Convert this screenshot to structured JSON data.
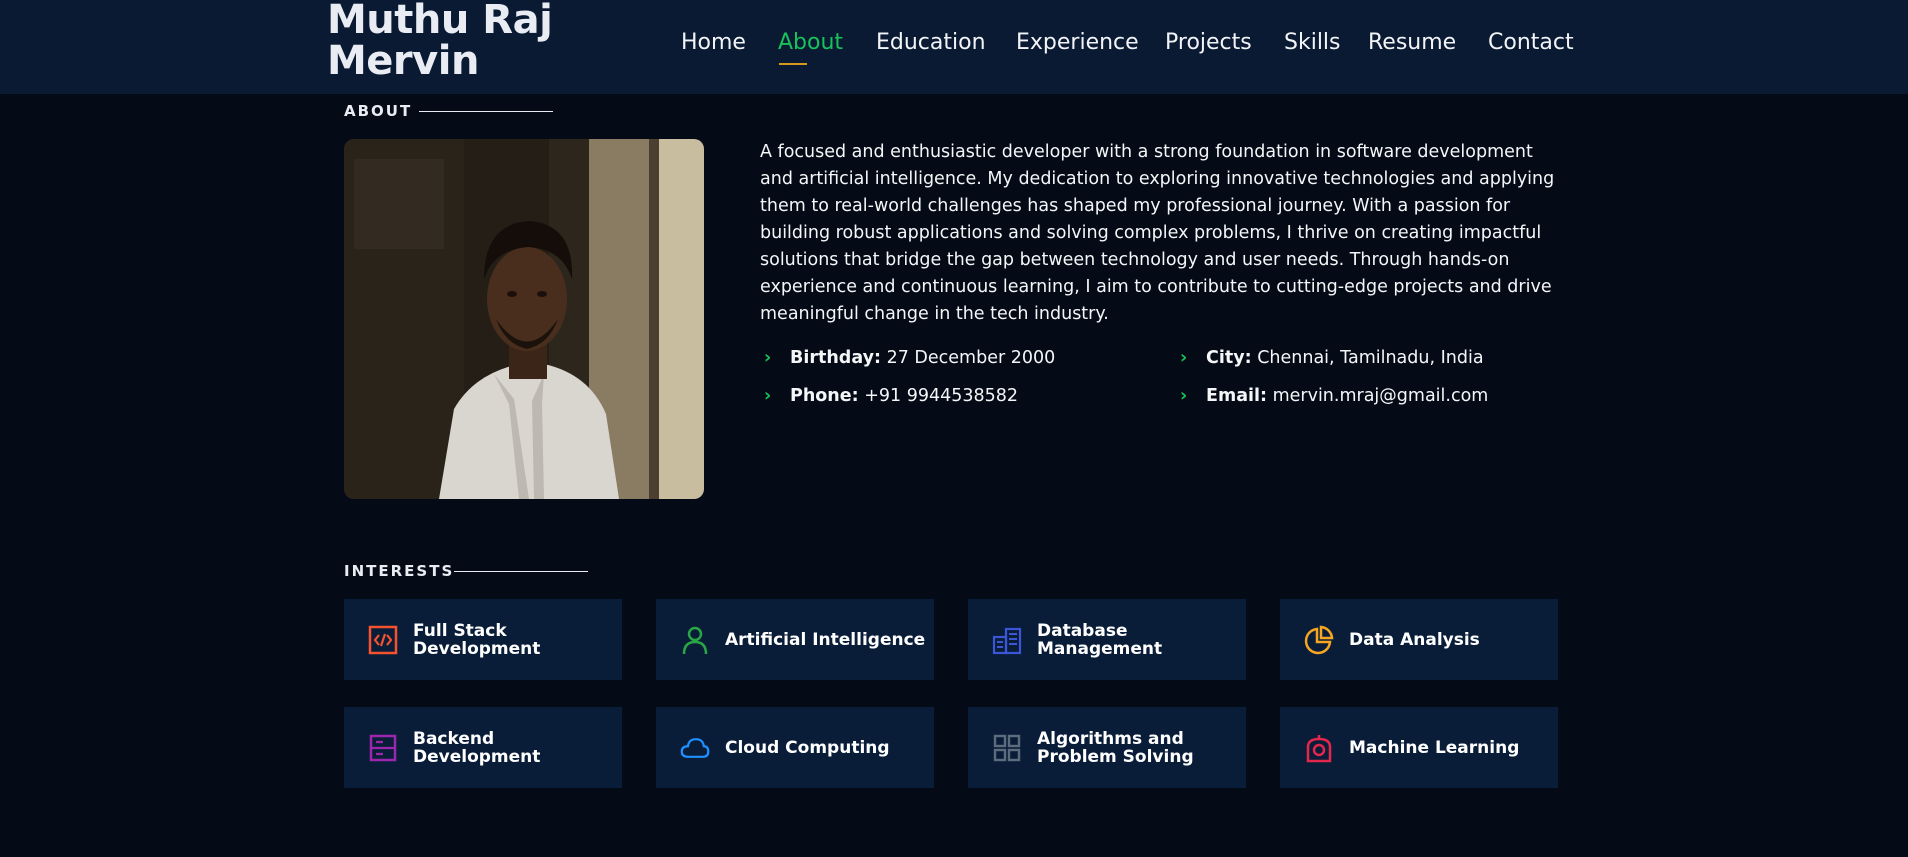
{
  "header": {
    "name_line1": "Muthu Raj",
    "name_line2": "Mervin",
    "nav": [
      "Home",
      "About",
      "Education",
      "Experience",
      "Projects",
      "Skills",
      "Resume",
      "Contact"
    ],
    "active_nav": "About"
  },
  "about": {
    "section_title": "ABOUT",
    "bio": "A focused and enthusiastic developer with a strong foundation in software development and artificial intelligence. My dedication to exploring innovative technologies and applying them to real-world challenges has shaped my professional journey. With a passion for building robust applications and solving complex problems, I thrive on creating impactful solutions that bridge the gap between technology and user needs. Through hands-on experience and continuous learning, I aim to contribute to cutting-edge projects and drive meaningful change in the tech industry.",
    "details": [
      {
        "label": "Birthday:",
        "value": "27 December 2000"
      },
      {
        "label": "City:",
        "value": "Chennai, Tamilnadu, India"
      },
      {
        "label": "Phone:",
        "value": "+91 9944538582"
      },
      {
        "label": "Email:",
        "value": "mervin.mraj@gmail.com"
      }
    ]
  },
  "interests": {
    "section_title": "INTERESTS",
    "items": [
      {
        "label": "Full Stack Development",
        "icon": "code-icon",
        "color": "#f4532e"
      },
      {
        "label": "Artificial Intelligence",
        "icon": "person-icon",
        "color": "#28a745"
      },
      {
        "label": "Database Management",
        "icon": "database-icon",
        "color": "#3b56d6"
      },
      {
        "label": "Data Analysis",
        "icon": "pie-chart-icon",
        "color": "#f5a623"
      },
      {
        "label": "Backend Development",
        "icon": "server-icon",
        "color": "#9b27af"
      },
      {
        "label": "Cloud Computing",
        "icon": "cloud-icon",
        "color": "#1e90ff"
      },
      {
        "label": "Algorithms and Problem Solving",
        "icon": "grid-icon",
        "color": "#5b6c7d"
      },
      {
        "label": "Machine Learning",
        "icon": "machine-learning-icon",
        "color": "#e3264c"
      }
    ]
  }
}
